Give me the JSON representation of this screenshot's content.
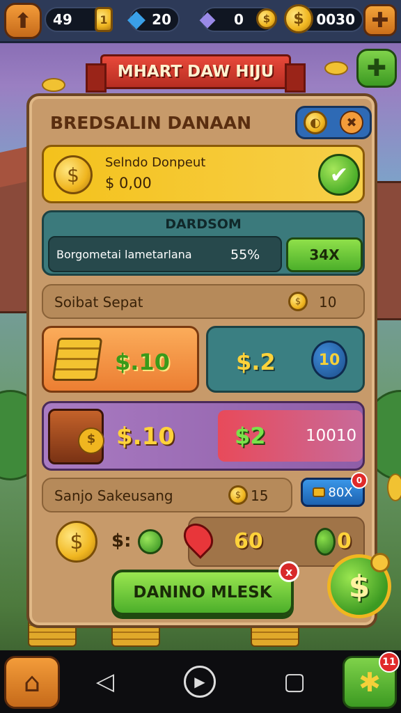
{
  "topbar": {
    "resource1": "49",
    "resource2": "20",
    "resource3": "0",
    "resource4": "0030"
  },
  "title": "MHART DAW HIJU",
  "panel": {
    "title": "BREDSALIN DANAAN",
    "deposit": {
      "label": "Selndo Donpeut",
      "value": "$ 0,00"
    },
    "bonus": {
      "header": "DARDSOM",
      "text": "Borgometai lametarlana",
      "percent": "55%",
      "button": "34X"
    },
    "row1": {
      "label": "Soibat Sepat",
      "value": "10"
    },
    "offer_orange": {
      "price": "$.10"
    },
    "offer_teal": {
      "price": "$.2",
      "badge": "10"
    },
    "chest_offer": {
      "price1": "$.10",
      "price2": "$2",
      "value": "10010"
    },
    "row2": {
      "label": "Sanjo Sakeusang",
      "value": "15",
      "pill": "80X",
      "pill_badge": "0"
    },
    "bottom": {
      "label": "$:",
      "amount": "60",
      "amount2": "0"
    },
    "cta": "DANINO MLESK",
    "cta_close": "x"
  },
  "nav": {
    "badge": "11"
  },
  "colors": {
    "panel": "#c79a6a",
    "accent_green": "#4caf2a",
    "accent_orange": "#ec7e32",
    "accent_red": "#e8493a"
  },
  "icons": [
    "arrow-up-icon",
    "coin-icon",
    "blue-gem-icon",
    "purple-gem-icon",
    "plus-icon",
    "check-icon",
    "chest-icon",
    "gold-bars-icon",
    "home-icon",
    "back-icon",
    "home-circle-icon",
    "recents-icon",
    "puzzle-icon"
  ]
}
